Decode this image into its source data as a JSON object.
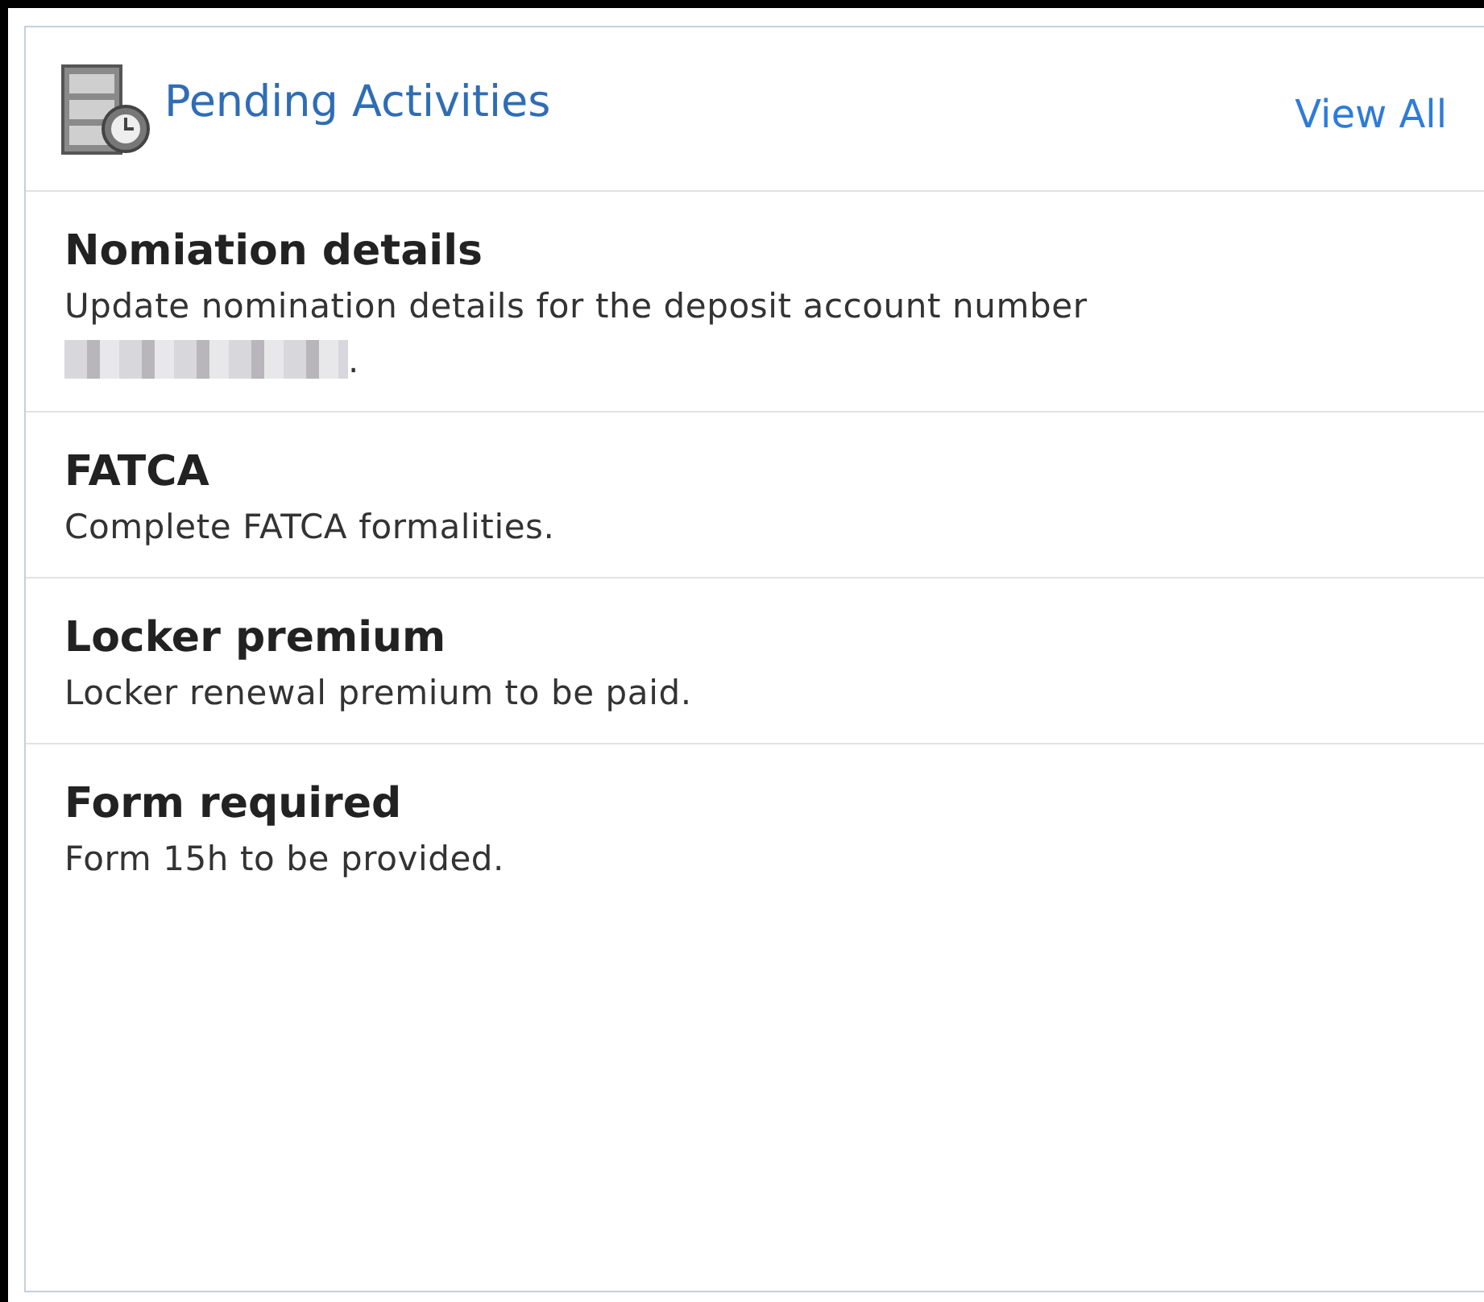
{
  "panel": {
    "title": "Pending Activities",
    "link": "View All"
  },
  "items": [
    {
      "title": "Nomiation details",
      "description": "Update nomination details for the deposit account number",
      "redacted": true,
      "suffix": "."
    },
    {
      "title": "FATCA",
      "description": "Complete FATCA formalities.",
      "redacted": false
    },
    {
      "title": "Locker premium",
      "description": "Locker renewal premium to be paid.",
      "redacted": false
    },
    {
      "title": "Form required",
      "description": "Form 15h to be provided.",
      "redacted": false
    }
  ]
}
